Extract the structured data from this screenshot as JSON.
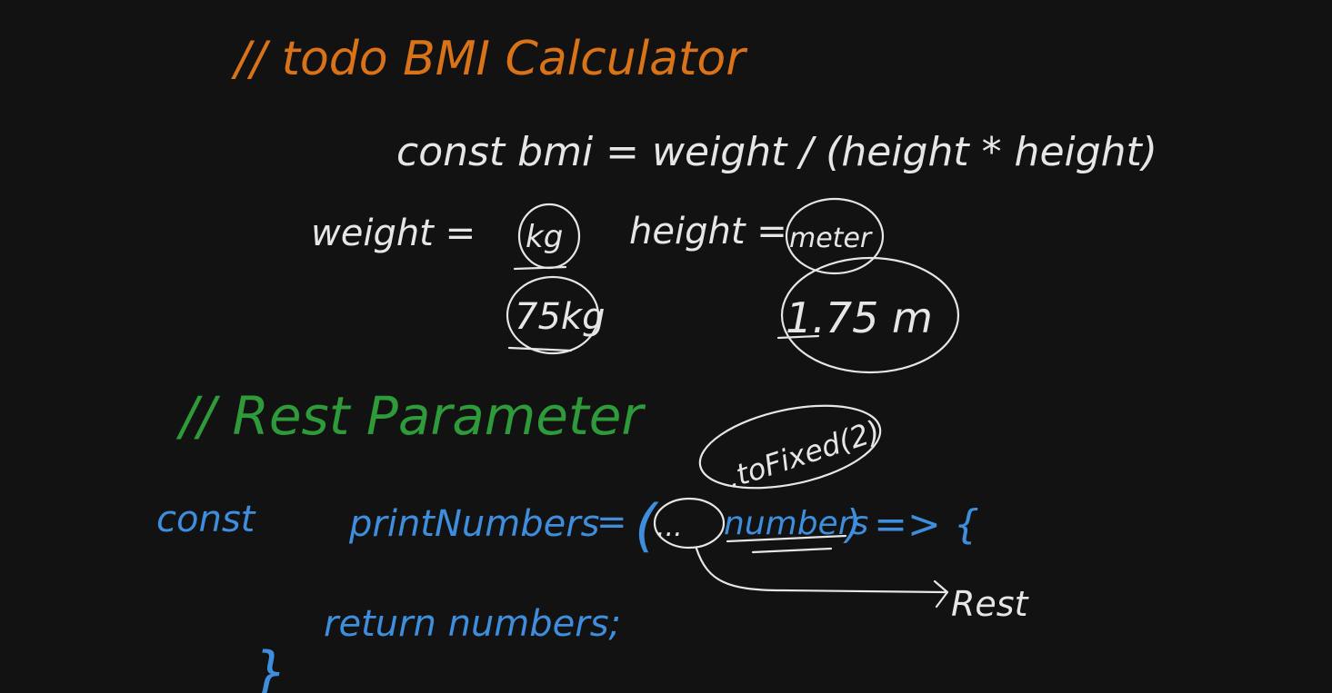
{
  "colors": {
    "background": "#121212",
    "orange": "#D9731A",
    "white": "#E6E6E6",
    "green": "#2E9A3A",
    "blue": "#3E8EDD"
  },
  "notes": {
    "todo_comment": "// todo   BMI Calculator",
    "bmi_formula": "const bmi =  weight / (height * height)",
    "weight_label": "weight =",
    "weight_unit": "kg",
    "height_label": "height =",
    "height_unit": "meter",
    "weight_example": "75kg",
    "height_example": "1.75 m",
    "rest_comment": "// Rest Parameter",
    "tofixed": ".toFixed(2)",
    "const_kw": "const",
    "fn_name": "printNumbers",
    "equals": "=",
    "open_paren": "(",
    "spread": "...",
    "param": "numbers",
    "close_arrow": ") => {",
    "rest_label": "Rest",
    "return_stmt": "return  numbers;",
    "close_brace": "}"
  }
}
